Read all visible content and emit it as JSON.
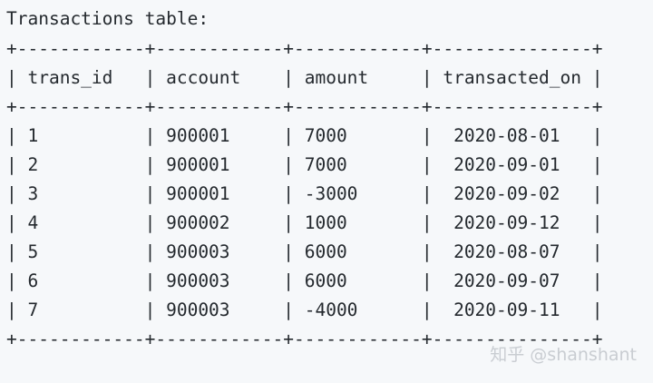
{
  "caption": "Transactions table:",
  "table": {
    "border_line": "+------------+------------+------------+---------------+",
    "header_line": "| trans_id   | account    | amount     | transacted_on |",
    "rows": [
      "| 1          | 900001     | 7000       |  2020-08-01   |",
      "| 2          | 900001     | 7000       |  2020-09-01   |",
      "| 3          | 900001     | -3000      |  2020-09-02   |",
      "| 4          | 900002     | 1000       |  2020-09-12   |",
      "| 5          | 900003     | 6000       |  2020-08-07   |",
      "| 6          | 900003     | 6000       |  2020-09-07   |",
      "| 7          | 900003     | -4000      |  2020-09-11   |"
    ],
    "columns": [
      "trans_id",
      "account",
      "amount",
      "transacted_on"
    ],
    "records": [
      {
        "trans_id": "1",
        "account": "900001",
        "amount": "7000",
        "transacted_on": "2020-08-01"
      },
      {
        "trans_id": "2",
        "account": "900001",
        "amount": "7000",
        "transacted_on": "2020-09-01"
      },
      {
        "trans_id": "3",
        "account": "900001",
        "amount": "-3000",
        "transacted_on": "2020-09-02"
      },
      {
        "trans_id": "4",
        "account": "900002",
        "amount": "1000",
        "transacted_on": "2020-09-12"
      },
      {
        "trans_id": "5",
        "account": "900003",
        "amount": "6000",
        "transacted_on": "2020-08-07"
      },
      {
        "trans_id": "6",
        "account": "900003",
        "amount": "6000",
        "transacted_on": "2020-09-07"
      },
      {
        "trans_id": "7",
        "account": "900003",
        "amount": "-4000",
        "transacted_on": "2020-09-11"
      }
    ]
  },
  "watermark": "知乎 @shanshant",
  "colors": {
    "background": "#f6f8fa",
    "text": "#24292e",
    "watermark": "#c9cdd2"
  }
}
